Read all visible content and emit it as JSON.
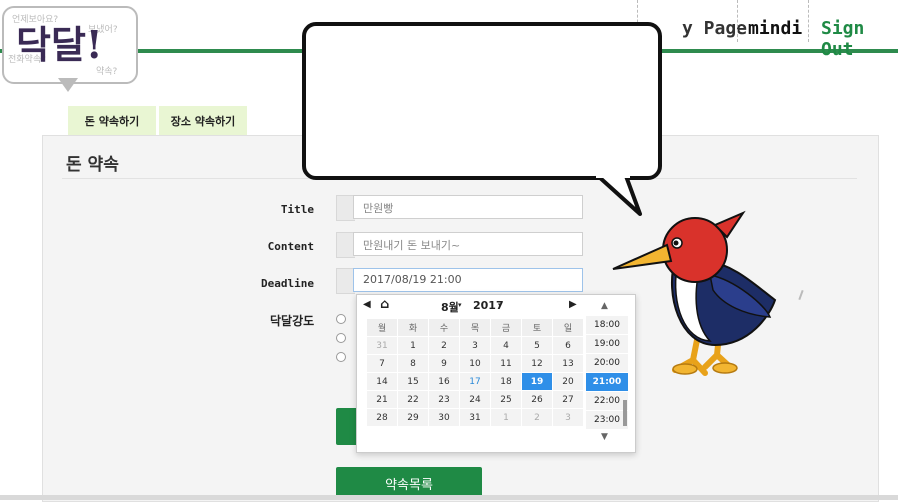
{
  "header": {
    "logo_text": "닥달!",
    "logo_bg_lines": [
      "언제보아요?",
      "전화약속?",
      "보냈어?",
      "약속?"
    ],
    "nav": [
      {
        "label": "y Page"
      },
      {
        "label": "mindi"
      },
      {
        "label": "Sign Out"
      }
    ]
  },
  "tabs": [
    {
      "label": "돈 약속하기"
    },
    {
      "label": "장소 약속하기"
    }
  ],
  "panel": {
    "title": "돈 약속"
  },
  "form": {
    "title_label": "Title",
    "title_placeholder": "만원빵",
    "content_label": "Content",
    "content_placeholder": "만원내기 돈 보내기~",
    "deadline_label": "Deadline",
    "deadline_value": "2017/08/19 21:00",
    "strength_label": "닥달강도"
  },
  "datepicker": {
    "prev_icon": "◀",
    "home_icon": "⌂",
    "next_icon": "▶",
    "month": "8월",
    "year": "2017",
    "weekdays": [
      "월",
      "화",
      "수",
      "목",
      "금",
      "토",
      "일"
    ],
    "weeks": [
      [
        "31",
        "1",
        "2",
        "3",
        "4",
        "5",
        "6"
      ],
      [
        "7",
        "8",
        "9",
        "10",
        "11",
        "12",
        "13"
      ],
      [
        "14",
        "15",
        "16",
        "17",
        "18",
        "19",
        "20"
      ],
      [
        "21",
        "22",
        "23",
        "24",
        "25",
        "26",
        "27"
      ],
      [
        "28",
        "29",
        "30",
        "31",
        "1",
        "2",
        "3"
      ]
    ],
    "times": [
      "18:00",
      "19:00",
      "20:00",
      "21:00",
      "22:00",
      "23:00"
    ],
    "selected_day": "19",
    "today_day": "17",
    "selected_time": "21:00"
  },
  "buttons": {
    "list_label": "약속목록"
  },
  "colors": {
    "accent_green": "#1f8a45",
    "selection_blue": "#2f8fe8",
    "tab_bg": "#e9f6d3"
  }
}
